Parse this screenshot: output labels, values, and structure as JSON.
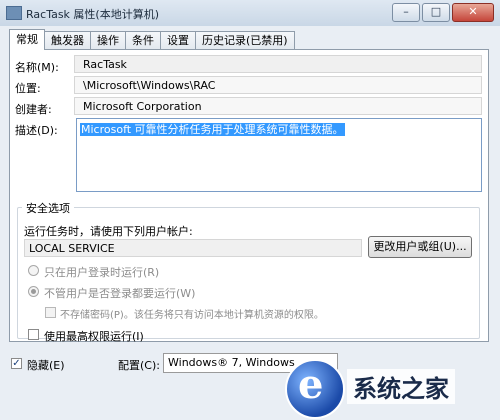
{
  "window": {
    "title": "RacTask 属性(本地计算机)",
    "buttons": {
      "minimize": "–",
      "maximize": "□",
      "close": "✕"
    }
  },
  "tabs": [
    "常规",
    "触发器",
    "操作",
    "条件",
    "设置",
    "历史记录(已禁用)"
  ],
  "general": {
    "name_label": "名称(M):",
    "name_value": "RacTask",
    "location_label": "位置:",
    "location_value": "\\Microsoft\\Windows\\RAC",
    "author_label": "创建者:",
    "author_value": "Microsoft Corporation",
    "description_label": "描述(D):",
    "description_value": "Microsoft 可靠性分析任务用于处理系统可靠性数据。"
  },
  "security": {
    "group_title": "安全选项",
    "run_as_label": "运行任务时，请使用下列用户帐户:",
    "account_value": "LOCAL SERVICE",
    "change_user_button": "更改用户或组(U)...",
    "radio_logged_on": "只在用户登录时运行(R)",
    "radio_whether": "不管用户是否登录都要运行(W)",
    "no_store_password": "不存储密码(P)。该任务将只有访问本地计算机资源的权限。",
    "highest_privileges": "使用最高权限运行(I)"
  },
  "footer": {
    "hidden_label": "隐藏(E)",
    "hidden_checked": true,
    "configure_label": "配置(C):",
    "configure_value": "Windows® 7, Windows"
  },
  "watermark": {
    "text": "系统之家"
  },
  "colors": {
    "selection": "#3399ff",
    "window_bg": "#e9eef4"
  }
}
